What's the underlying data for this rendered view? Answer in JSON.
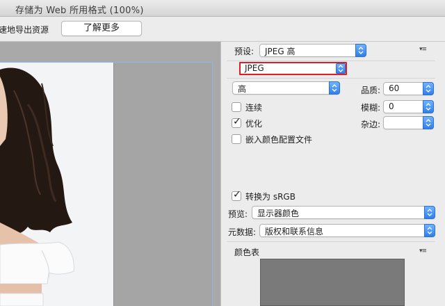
{
  "window": {
    "title": "存储为 Web 所用格式 (100%)"
  },
  "topbar": {
    "tip_text": "快速地导出资源",
    "learn_more_label": "了解更多"
  },
  "settings": {
    "preset_label": "预设:",
    "preset_value": "JPEG 高",
    "format_value": "JPEG",
    "quality_level_value": "高",
    "quality_label": "品质:",
    "quality_value": "60",
    "blur_label": "模糊:",
    "blur_value": "0",
    "matte_label": "杂边:",
    "matte_value": "",
    "progressive_label": "连续",
    "progressive_checked": false,
    "optimized_label": "优化",
    "optimized_checked": true,
    "embed_profile_label": "嵌入颜色配置文件",
    "embed_profile_checked": false,
    "convert_srgb_label": "转换为 sRGB",
    "convert_srgb_checked": true,
    "preview_label": "预览:",
    "preview_value": "显示器颜色",
    "metadata_label": "元数据:",
    "metadata_value": "版权和联系信息",
    "color_table_label": "颜色表"
  },
  "icons": {
    "panel_menu": "panel-menu-icon",
    "stepper": "up-down-arrows-icon",
    "checkmark": "checkmark-icon"
  },
  "colors": {
    "stepper_blue": "#3a8cf5",
    "format_highlight": "#d9202a",
    "focus_ring": "#8cb4e8"
  }
}
